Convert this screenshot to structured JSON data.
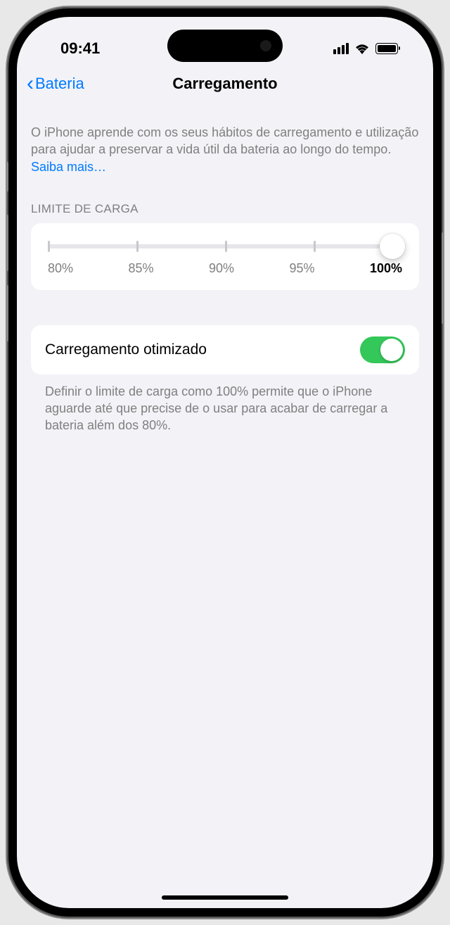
{
  "status_bar": {
    "time": "09:41"
  },
  "nav": {
    "back_label": "Bateria",
    "title": "Carregamento"
  },
  "description": {
    "text": "O iPhone aprende com os seus hábitos de carregamento e utilização para ajudar a preservar a vida útil da bateria ao longo do tempo. ",
    "link": "Saiba mais…"
  },
  "charge_limit": {
    "header": "LIMITE DE CARGA",
    "labels": [
      "80%",
      "85%",
      "90%",
      "95%",
      "100%"
    ]
  },
  "optimized": {
    "label": "Carregamento otimizado"
  },
  "footer": "Definir o limite de carga como 100% permite que o iPhone aguarde até que precise de o usar para acabar de carregar a bateria além dos 80%."
}
